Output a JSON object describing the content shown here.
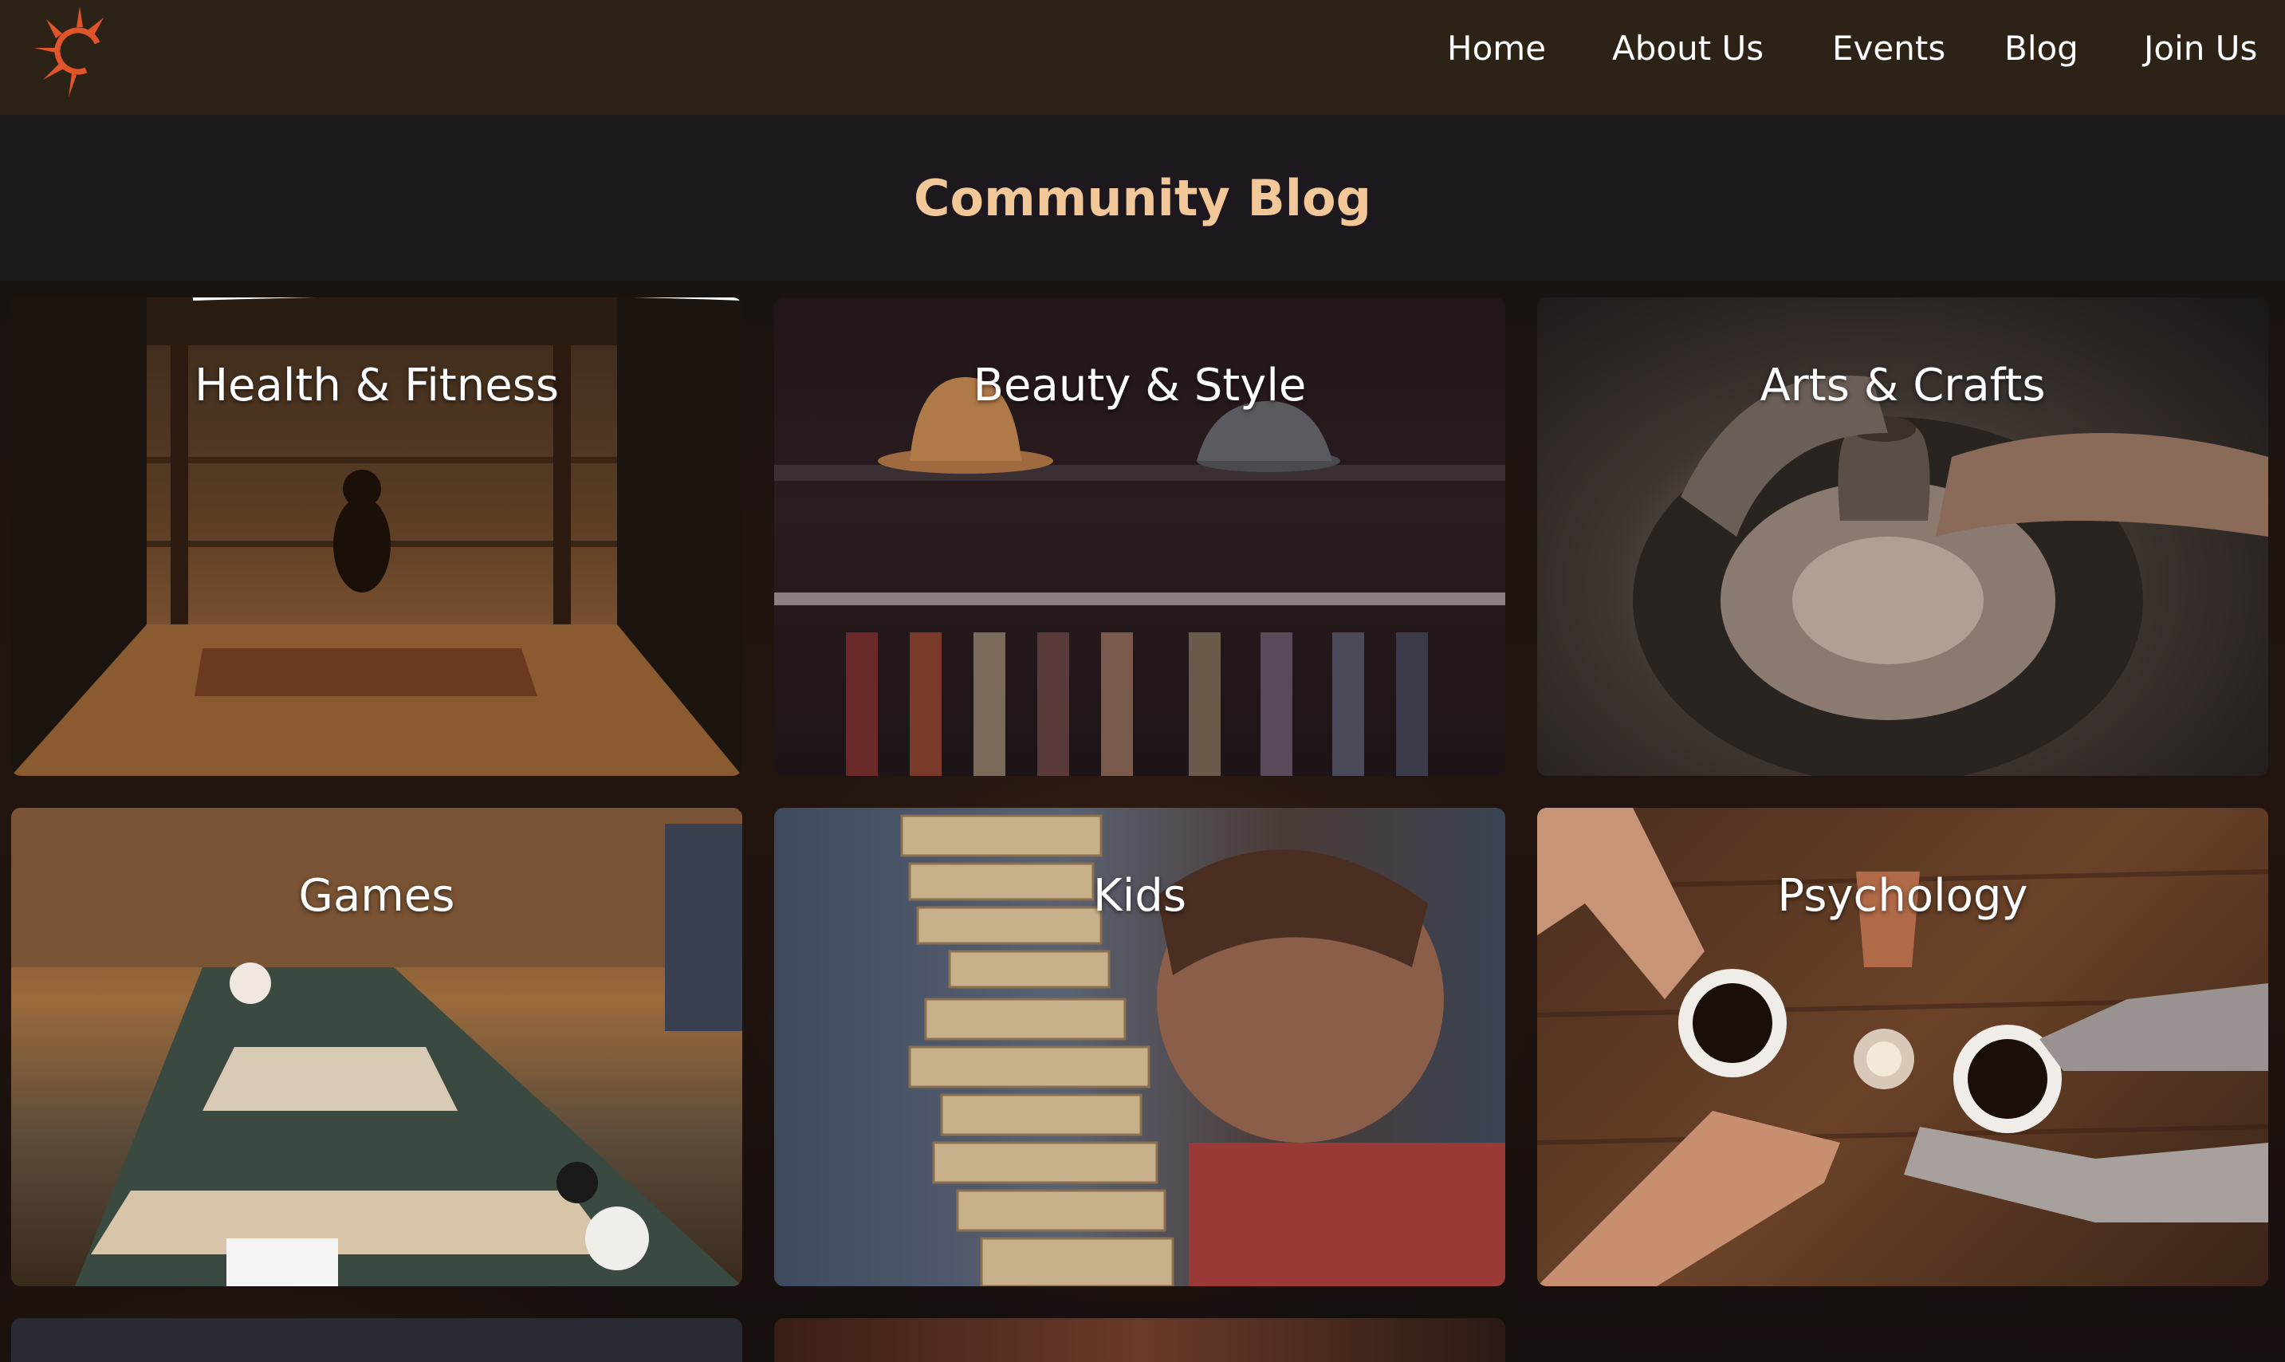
{
  "nav": {
    "logo_name": "sun-logo",
    "links": [
      "Home",
      "About Us",
      "Events",
      "Blog",
      "Join Us"
    ]
  },
  "header": {
    "title": "Community Blog"
  },
  "categories": [
    "Health & Fitness",
    "Beauty & Style",
    "Arts & Crafts",
    "Games",
    "Kids",
    "Psychology"
  ],
  "colors": {
    "nav_bg": "#2d2216",
    "page_bg": "#1c181d",
    "title": "#f2c898",
    "logo": "#e0562a"
  }
}
